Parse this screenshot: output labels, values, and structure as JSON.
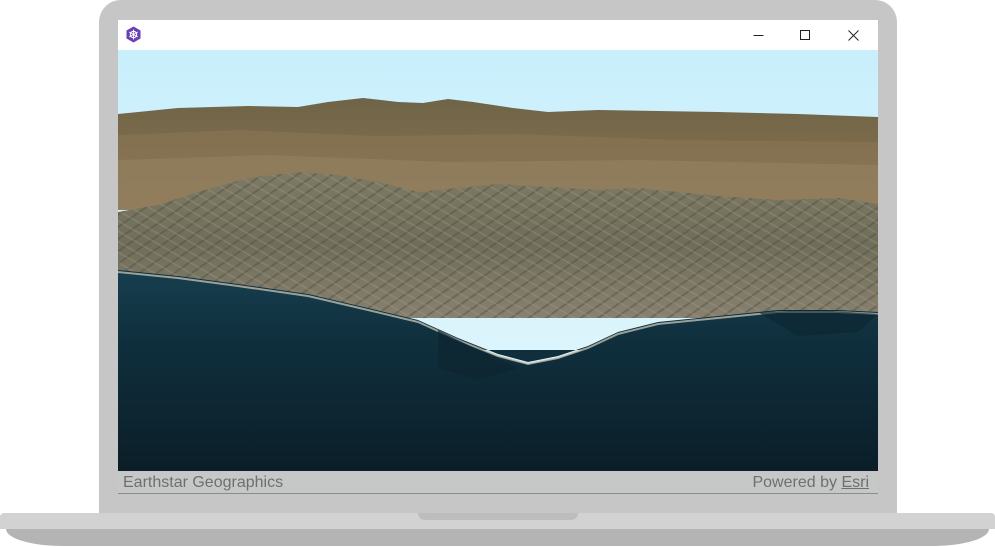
{
  "window": {
    "app_icon": "arcgis-hexagon-icon",
    "controls": {
      "minimize_icon": "minimize-icon",
      "maximize_icon": "maximize-icon",
      "close_icon": "close-icon"
    }
  },
  "map": {
    "scene": "3D coastal terrain satellite view",
    "attribution": {
      "source": "Earthstar Geographics",
      "powered_by_prefix": "Powered by",
      "powered_by_link": "Esri"
    }
  },
  "colors": {
    "accent": "#6a3fb5",
    "sky_top": "#c8eefc",
    "ocean": "#0f2c3a",
    "frame": "#c6c6c6"
  }
}
